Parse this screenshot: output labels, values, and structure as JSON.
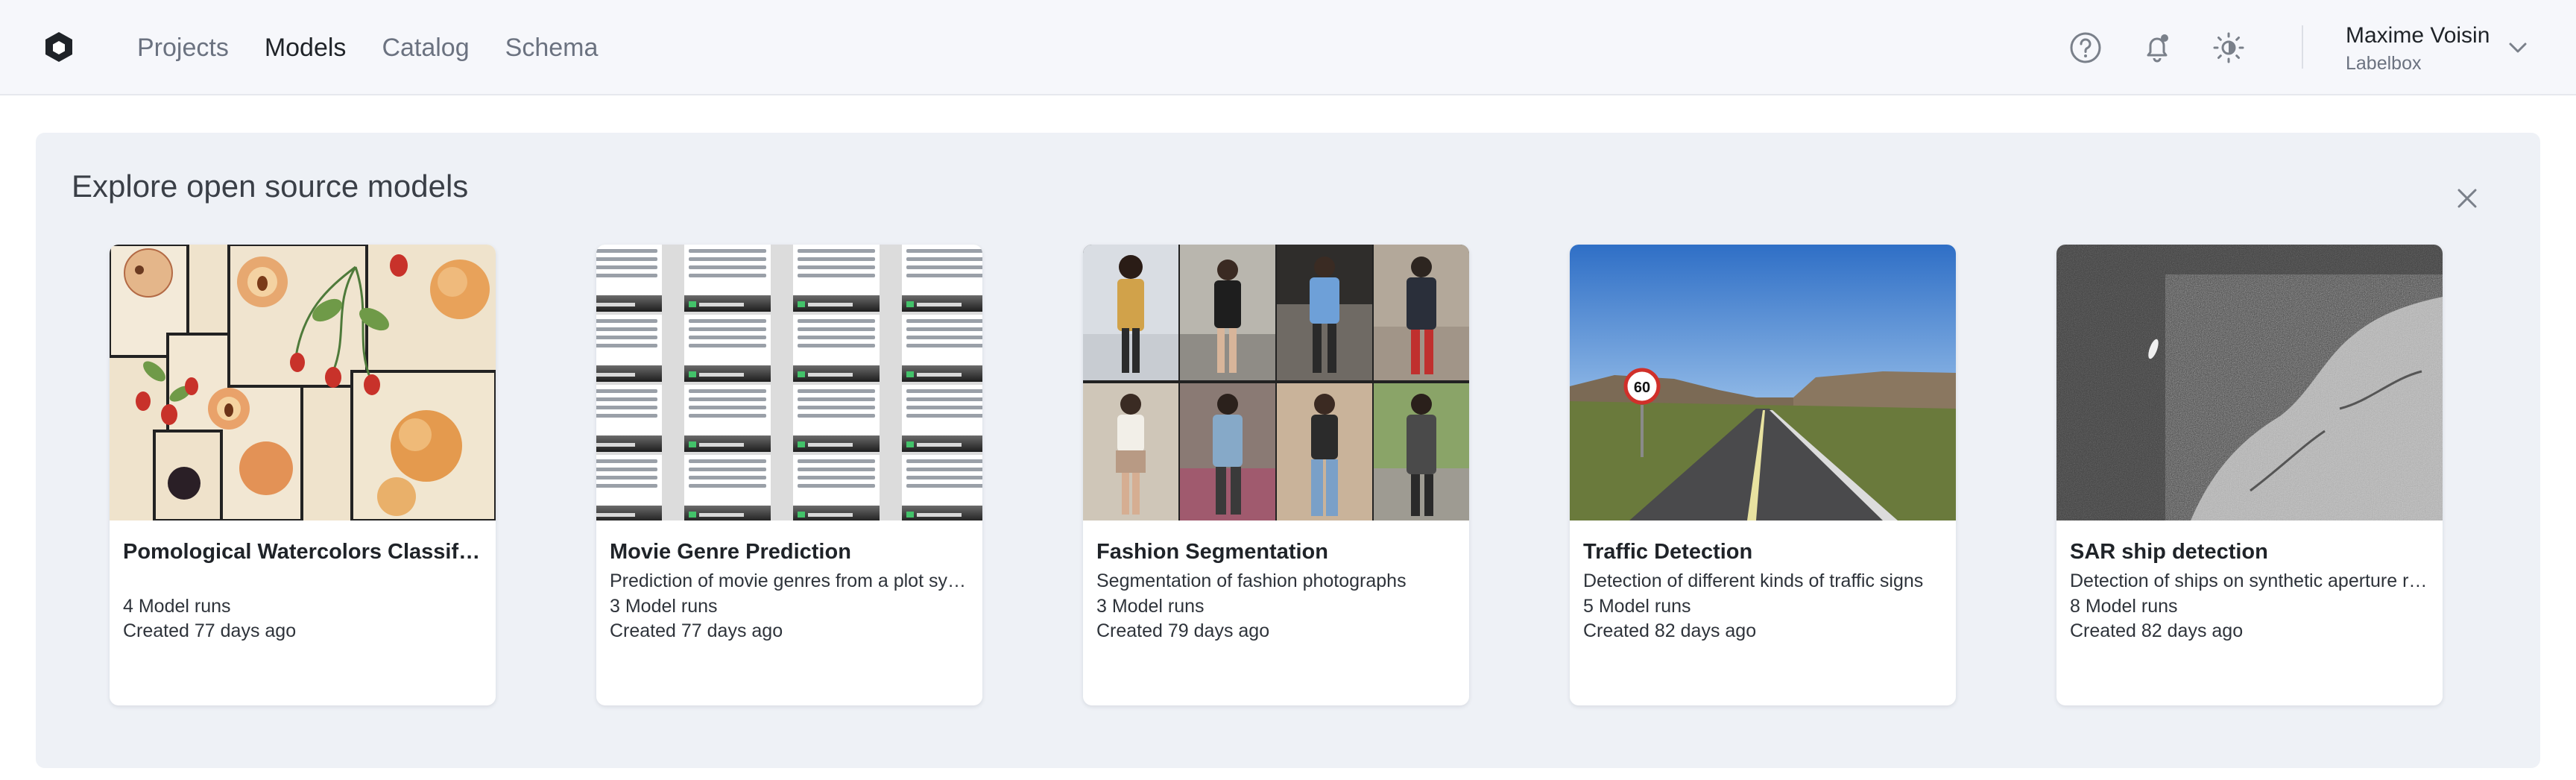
{
  "header": {
    "nav": [
      {
        "label": "Projects",
        "active": false
      },
      {
        "label": "Models",
        "active": true
      },
      {
        "label": "Catalog",
        "active": false
      },
      {
        "label": "Schema",
        "active": false
      }
    ],
    "icons": [
      "help-circle-icon",
      "notification-bell-icon",
      "theme-toggle-icon"
    ],
    "user": {
      "name": "Maxime Voisin",
      "org": "Labelbox"
    }
  },
  "explore": {
    "title": "Explore open source models",
    "cards": [
      {
        "title": "Pomological Watercolors Classificat...",
        "description": "",
        "runs": "4 Model runs",
        "created": "Created 77 days ago"
      },
      {
        "title": "Movie Genre Prediction",
        "description": "Prediction of movie genres from a plot syn...",
        "runs": "3 Model runs",
        "created": "Created 77 days ago"
      },
      {
        "title": "Fashion Segmentation",
        "description": "Segmentation of fashion photographs",
        "runs": "3 Model runs",
        "created": "Created 79 days ago"
      },
      {
        "title": "Traffic Detection",
        "description": "Detection of different kinds of traffic signs",
        "runs": "5 Model runs",
        "created": "Created 82 days ago"
      },
      {
        "title": "SAR ship detection",
        "description": "Detection of ships on synthetic aperture ra...",
        "runs": "8 Model runs",
        "created": "Created 82 days ago"
      }
    ]
  },
  "colors": {
    "header_bg": "#f6f7fb",
    "panel_bg": "#eef1f6",
    "text": "#1f2328",
    "muted": "#6b7280"
  }
}
